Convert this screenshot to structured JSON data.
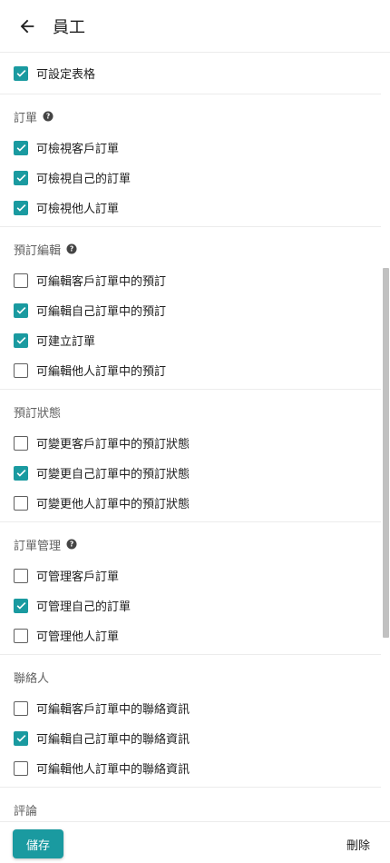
{
  "header": {
    "title": "員工"
  },
  "colors": {
    "accent": "#1a9aa0"
  },
  "sections": [
    {
      "title": "",
      "help": false,
      "items": [
        {
          "label": "可設定表格",
          "checked": true
        }
      ]
    },
    {
      "title": "訂單",
      "help": true,
      "items": [
        {
          "label": "可檢視客戶訂單",
          "checked": true
        },
        {
          "label": "可檢視自己的訂單",
          "checked": true
        },
        {
          "label": "可檢視他人訂單",
          "checked": true
        }
      ]
    },
    {
      "title": "預訂編輯",
      "help": true,
      "items": [
        {
          "label": "可編輯客戶訂單中的預訂",
          "checked": false
        },
        {
          "label": "可編輯自己訂單中的預訂",
          "checked": true
        },
        {
          "label": "可建立訂單",
          "checked": true
        },
        {
          "label": "可編輯他人訂單中的預訂",
          "checked": false
        }
      ]
    },
    {
      "title": "預訂狀態",
      "help": false,
      "items": [
        {
          "label": "可變更客戶訂單中的預訂狀態",
          "checked": false
        },
        {
          "label": "可變更自己訂單中的預訂狀態",
          "checked": true
        },
        {
          "label": "可變更他人訂單中的預訂狀態",
          "checked": false
        }
      ]
    },
    {
      "title": "訂單管理",
      "help": true,
      "items": [
        {
          "label": "可管理客戶訂單",
          "checked": false
        },
        {
          "label": "可管理自己的訂單",
          "checked": true
        },
        {
          "label": "可管理他人訂單",
          "checked": false
        }
      ]
    },
    {
      "title": "聯絡人",
      "help": false,
      "items": [
        {
          "label": "可編輯客戶訂單中的聯絡資訊",
          "checked": false
        },
        {
          "label": "可編輯自己訂單中的聯絡資訊",
          "checked": true
        },
        {
          "label": "可編輯他人訂單中的聯絡資訊",
          "checked": false
        }
      ]
    },
    {
      "title": "評論",
      "help": false,
      "items": []
    }
  ],
  "footer": {
    "save_label": "儲存",
    "delete_label": "刪除"
  }
}
